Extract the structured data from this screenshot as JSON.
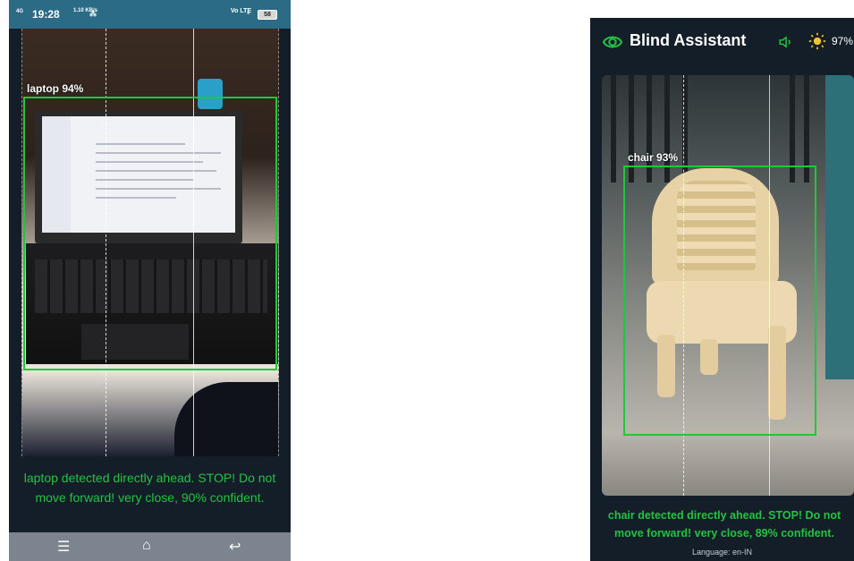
{
  "phone1": {
    "status": {
      "network": "4G",
      "time": "19:28",
      "speed": "1.10 KB/s",
      "sig": "⁂",
      "lte": "Vo LTE",
      "battery": "58"
    },
    "detection": {
      "label": "laptop 94%"
    },
    "message": "laptop detected directly ahead. STOP! Do not move forward! very close, 90% confident.",
    "nav": {
      "menu": "☰",
      "home": "⌂",
      "back": "↩"
    }
  },
  "phone2": {
    "app_title": "Blind Assistant",
    "confidence_readout": "97%",
    "detection": {
      "label": "chair 93%"
    },
    "message": "chair detected directly ahead. STOP! Do not move forward! very close, 89% confident.",
    "language": "Language: en-IN",
    "icons": [
      "eye-icon",
      "speaker-icon",
      "sun-icon"
    ],
    "accent": "#25c241"
  }
}
